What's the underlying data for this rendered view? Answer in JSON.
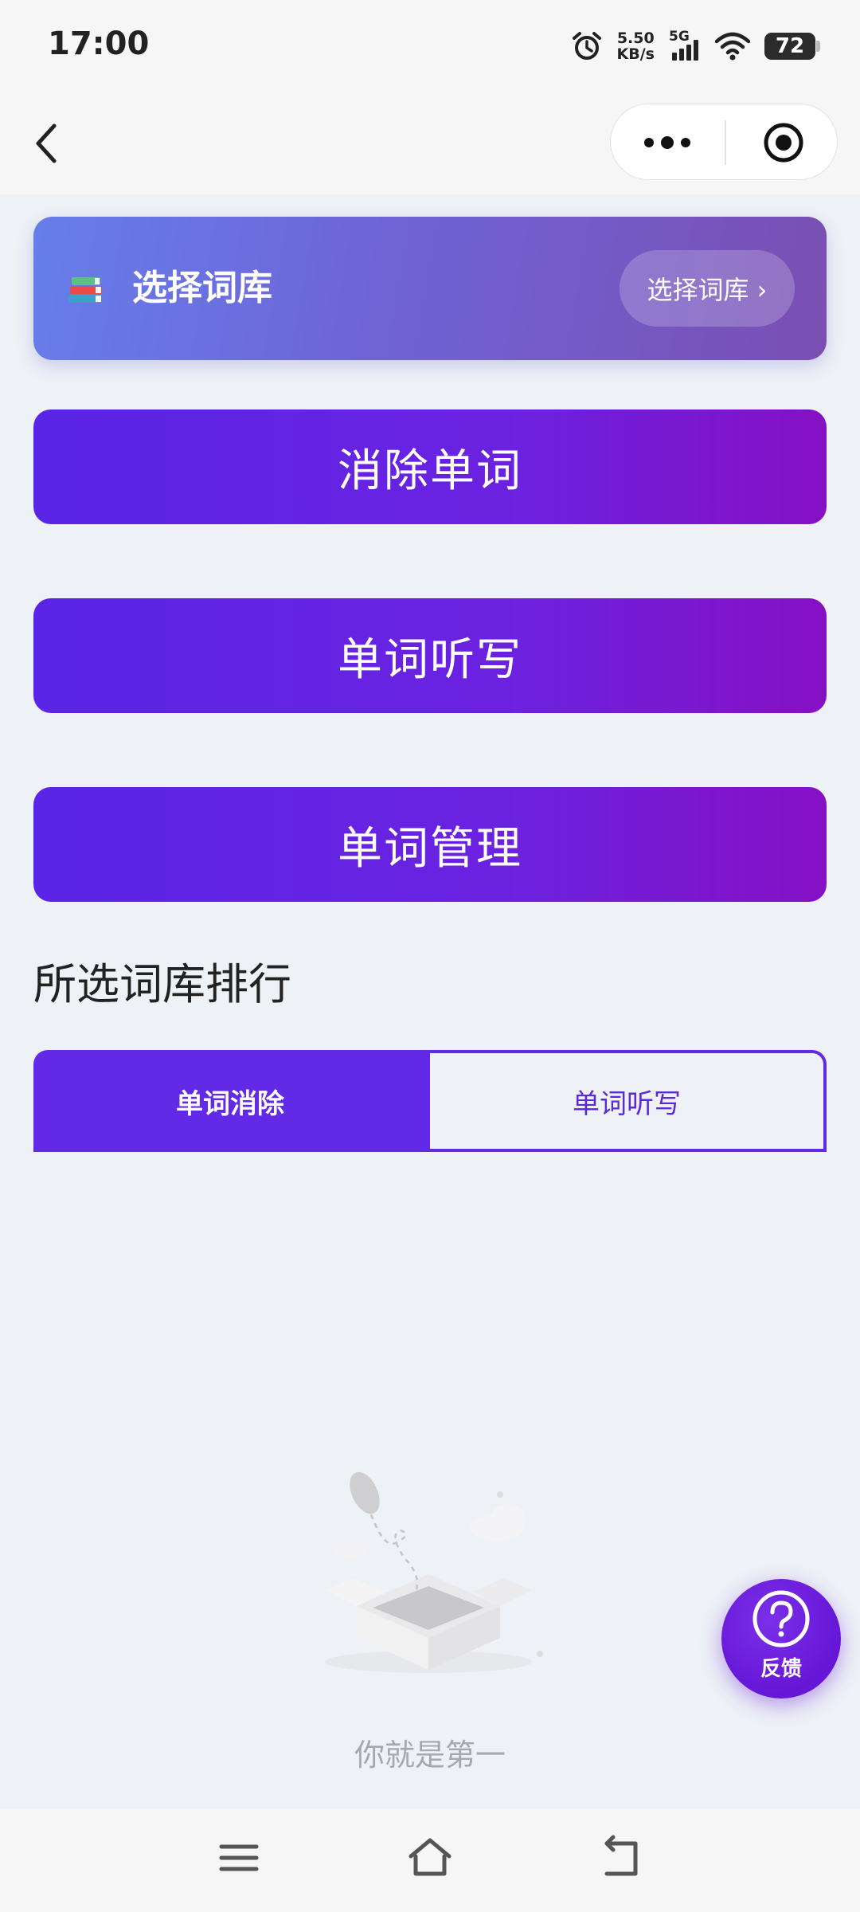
{
  "status_bar": {
    "time": "17:00",
    "net_speed_value": "5.50",
    "net_speed_unit": "KB/s",
    "network": "5G",
    "battery": "72"
  },
  "nav": {
    "back_icon": "chevron-left-icon",
    "more_icon": "more-dots-icon",
    "close_icon": "target-icon"
  },
  "banner": {
    "icon": "books-icon",
    "title": "选择词库",
    "button_label": "选择词库 ›"
  },
  "actions": [
    {
      "label": "消除单词"
    },
    {
      "label": "单词听写"
    },
    {
      "label": "单词管理"
    }
  ],
  "ranking": {
    "title": "所选词库排行",
    "tabs": [
      {
        "label": "单词消除",
        "active": true
      },
      {
        "label": "单词听写",
        "active": false
      }
    ],
    "empty_text": "你就是第一"
  },
  "feedback": {
    "label": "反馈",
    "icon": "question-circle-icon"
  },
  "system_nav": {
    "menu_icon": "menu-icon",
    "home_icon": "home-icon",
    "back_icon": "return-icon"
  },
  "colors": {
    "accent": "#6229e6",
    "banner_start": "#667eea",
    "banner_end": "#7a4fb2",
    "background": "#eef1f6"
  }
}
